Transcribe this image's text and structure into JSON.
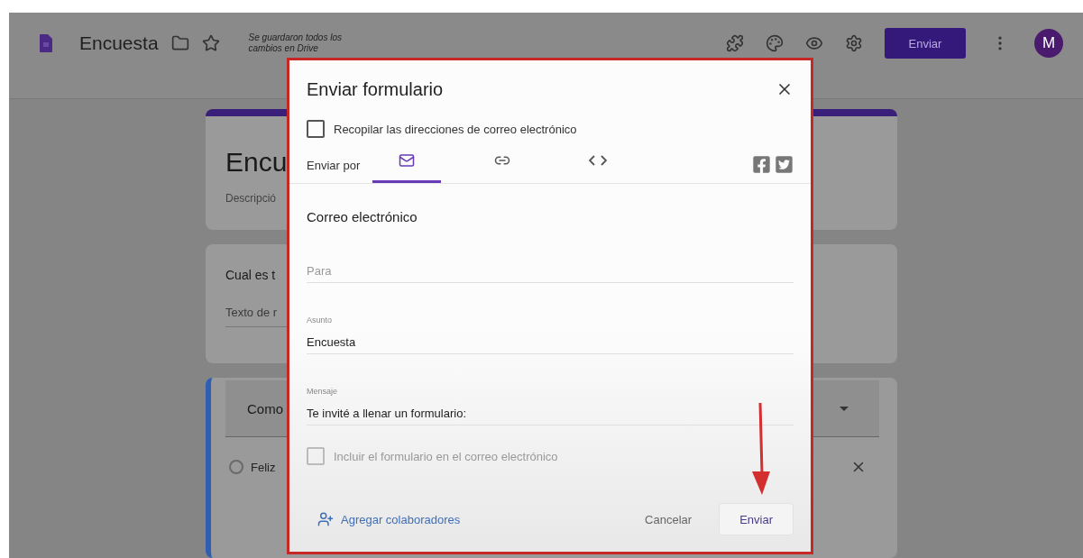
{
  "app_bar": {
    "title": "Encuesta",
    "save_status": "Se guardaron todos los cambios en Drive",
    "send_button": "Enviar",
    "avatar": "M"
  },
  "form": {
    "title": "Encu",
    "description": "Descripció",
    "questions": [
      {
        "kind": "text",
        "title": "Cual es t",
        "answer_placeholder": "Texto de r"
      },
      {
        "kind": "choice",
        "title": "Como",
        "options": [
          {
            "label": "Feliz",
            "selected": false
          }
        ]
      }
    ]
  },
  "dialog": {
    "title": "Enviar formulario",
    "collect_emails": {
      "label": "Recopilar las direcciones de correo electrónico",
      "checked": false
    },
    "send_via_label": "Enviar por",
    "tabs": [
      {
        "kind": "email",
        "selected": true
      },
      {
        "kind": "link",
        "selected": false
      },
      {
        "kind": "embed",
        "selected": false
      }
    ],
    "section_title": "Correo electrónico",
    "fields": [
      {
        "placeholder": "Para"
      },
      {
        "label": "Asunto",
        "value": "Encuesta"
      },
      {
        "label": "Mensaje",
        "value": "Te invité a llenar un formulario:"
      }
    ],
    "include_form": {
      "label": "Incluir el formulario en el correo electrónico",
      "checked": false,
      "disabled": true
    },
    "add_collaborators": "Agregar colaboradores",
    "buttons": [
      {
        "kind": "text",
        "label": "Cancelar"
      },
      {
        "kind": "outlined",
        "label": "Enviar"
      }
    ]
  }
}
